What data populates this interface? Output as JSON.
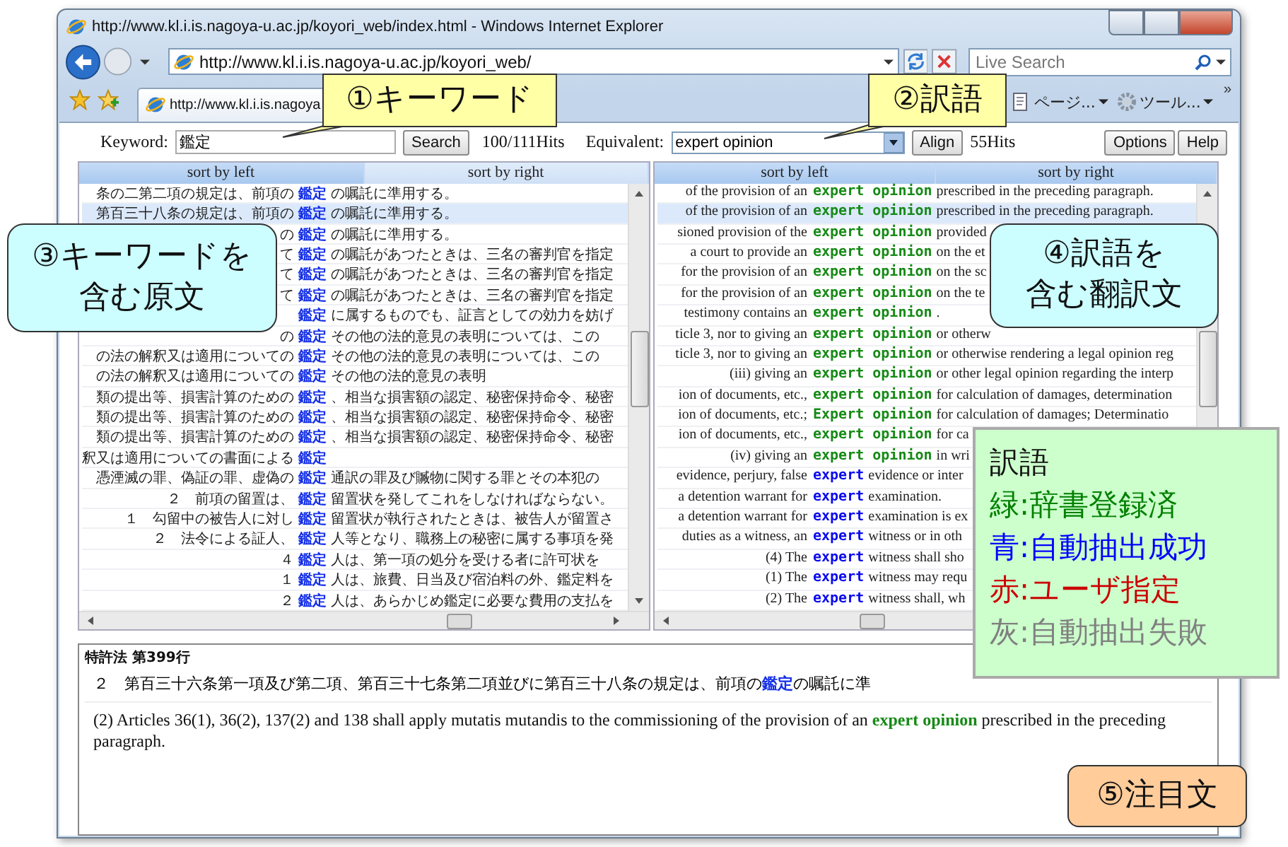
{
  "window": {
    "title": "http://www.kl.i.is.nagoya-u.ac.jp/koyori_web/index.html - Windows Internet Explorer"
  },
  "address_bar": {
    "url": "http://www.kl.i.is.nagoya-u.ac.jp/koyori_web/"
  },
  "search_box": {
    "placeholder": "Live Search"
  },
  "tab": {
    "title": "http://www.kl.i.is.nagoya"
  },
  "command_bar": [
    {
      "label": "ページ...",
      "kind": "page"
    },
    {
      "label": "ツール...",
      "kind": "tools"
    }
  ],
  "overflow": "»",
  "toolbar": {
    "keyword_label": "Keyword:",
    "keyword": "鑑定",
    "search_button": "Search",
    "hits": "100/111Hits",
    "equivalent_label": "Equivalent:",
    "equivalent": "expert opinion",
    "align_button": "Align",
    "equivalent_hits": "55Hits",
    "buttons": [
      "Options",
      "Help"
    ]
  },
  "panes": [
    {
      "headers": [
        "sort by left",
        "sort by right"
      ]
    },
    {
      "headers": [
        "sort by left",
        "sort by right"
      ]
    }
  ],
  "rows": [
    {
      "selected": false,
      "source": {
        "pre": "条の二第二項の規定は、前項の",
        "key": "鑑定",
        "post": "の嘱託に準用する。"
      },
      "translation": {
        "pre": "of the provision of an",
        "term": "expert opinion",
        "post": "prescribed in the preceding paragraph.",
        "kind": "dictionary"
      }
    },
    {
      "selected": true,
      "source": {
        "pre": "第百三十八条の規定は、前項の",
        "key": "鑑定",
        "post": "の嘱託に準用する。"
      },
      "translation": {
        "pre": "of the provision of an",
        "term": "expert opinion",
        "post": "prescribed in the preceding paragraph.",
        "kind": "dictionary"
      }
    },
    {
      "selected": false,
      "source": {
        "pre": "の",
        "key": "鑑定",
        "post": "の嘱託に準用する。"
      },
      "translation": {
        "pre": "sioned provision of the",
        "term": "expert opinion",
        "post": "provided",
        "kind": "dictionary"
      }
    },
    {
      "selected": false,
      "source": {
        "pre": "て",
        "key": "鑑定",
        "post": "の嘱託があつたときは、三名の審判官を指定"
      },
      "translation": {
        "pre": "a court to provide an",
        "term": "expert opinion",
        "post": "on the et",
        "kind": "dictionary"
      }
    },
    {
      "selected": false,
      "source": {
        "pre": "て",
        "key": "鑑定",
        "post": "の嘱託があつたときは、三名の審判官を指定"
      },
      "translation": {
        "pre": "for the provision of an",
        "term": "expert opinion",
        "post": "on the sc",
        "kind": "dictionary"
      }
    },
    {
      "selected": false,
      "source": {
        "pre": "て",
        "key": "鑑定",
        "post": "の嘱託があつたときは、三名の審判官を指定"
      },
      "translation": {
        "pre": "for the provision of an",
        "term": "expert opinion",
        "post": "on the te",
        "kind": "dictionary"
      }
    },
    {
      "selected": false,
      "source": {
        "key": "鑑定",
        "post": "に属するものでも、証言としての効力を妨げ"
      },
      "translation": {
        "pre": "testimony contains an",
        "term": "expert opinion",
        "post": ".",
        "kind": "dictionary"
      }
    },
    {
      "selected": false,
      "source": {
        "pre": "の",
        "key": "鑑定",
        "post": "その他の法的意見の表明については、この"
      },
      "translation": {
        "pre": "ticle 3, nor to giving an",
        "term": "expert opinion",
        "post": "or otherw",
        "kind": "dictionary"
      }
    },
    {
      "selected": false,
      "source": {
        "pre": "の法の解釈又は適用についての",
        "key": "鑑定",
        "post": "その他の法的意見の表明については、この"
      },
      "translation": {
        "pre": "ticle 3, nor to giving an",
        "term": "expert opinion",
        "post": "or otherwise rendering a legal opinion reg",
        "kind": "dictionary"
      }
    },
    {
      "selected": false,
      "source": {
        "pre": "の法の解釈又は適用についての",
        "key": "鑑定",
        "post": "その他の法的意見の表明"
      },
      "translation": {
        "pre": "(iii) giving an",
        "term": "expert opinion",
        "post": "or other legal opinion regarding the interp",
        "kind": "dictionary"
      }
    },
    {
      "selected": false,
      "source": {
        "pre": "類の提出等、損害計算のための",
        "key": "鑑定",
        "post": "、相当な損害額の認定、秘密保持命令、秘密"
      },
      "translation": {
        "pre": "ion of documents, etc.,",
        "term": "expert opinion",
        "post": "for calculation of damages, determination",
        "kind": "dictionary"
      }
    },
    {
      "selected": false,
      "source": {
        "pre": "類の提出等、損害計算のための",
        "key": "鑑定",
        "post": "、相当な損害額の認定、秘密保持命令、秘密"
      },
      "translation": {
        "pre": "ion of documents, etc.;",
        "term": "Expert opinion",
        "post": "for calculation of damages; Determinatio",
        "kind": "dictionary"
      }
    },
    {
      "selected": false,
      "source": {
        "pre": "類の提出等、損害計算のための",
        "key": "鑑定",
        "post": "、相当な損害額の認定、秘密保持命令、秘密"
      },
      "translation": {
        "pre": "ion of documents, etc.,",
        "term": "expert opinion",
        "post": "for ca",
        "kind": "dictionary"
      }
    },
    {
      "selected": false,
      "source": {
        "pre": "釈又は適用についての書面による",
        "key": "鑑定"
      },
      "translation": {
        "pre": "(iv) giving an",
        "term": "expert opinion",
        "post": "in wri",
        "kind": "dictionary"
      }
    },
    {
      "selected": false,
      "source": {
        "pre": "憑湮滅の罪、偽証の罪、虚偽の",
        "key": "鑑定",
        "post": "通訳の罪及び贓物に関する罪とその本犯の"
      },
      "translation": {
        "pre": "evidence, perjury, false",
        "term": "expert",
        "post": "evidence or inter",
        "kind": "auto"
      }
    },
    {
      "selected": false,
      "source": {
        "pre": "２　前項の留置は、",
        "key": "鑑定",
        "post": "留置状を発してこれをしなければならない。"
      },
      "translation": {
        "pre": "a detention warrant for",
        "term": "expert",
        "post": "examination.",
        "kind": "auto"
      }
    },
    {
      "selected": false,
      "source": {
        "pre": "１　勾留中の被告人に対し",
        "key": "鑑定",
        "post": "留置状が執行されたときは、被告人が留置さ"
      },
      "translation": {
        "pre": "a detention warrant for",
        "term": "expert",
        "post": "examination is ex",
        "kind": "auto"
      }
    },
    {
      "selected": false,
      "source": {
        "pre": "２　法令による証人、",
        "key": "鑑定",
        "post": "人等となり、職務上の秘密に属する事項を発"
      },
      "translation": {
        "pre": "duties as a witness, an",
        "term": "expert",
        "post": "witness or in oth",
        "kind": "auto"
      }
    },
    {
      "selected": false,
      "source": {
        "pre": "４",
        "key": "鑑定",
        "post": "人は、第一項の処分を受ける者に許可状を"
      },
      "translation": {
        "pre": "(4) The",
        "term": "expert",
        "post": "witness shall sho",
        "kind": "auto"
      }
    },
    {
      "selected": false,
      "source": {
        "pre": "１",
        "key": "鑑定",
        "post": "人は、旅費、日当及び宿泊料の外、鑑定料を"
      },
      "translation": {
        "pre": "(1) The",
        "term": "expert",
        "post": "witness may requ",
        "kind": "auto"
      }
    },
    {
      "selected": false,
      "source": {
        "pre": "２",
        "key": "鑑定",
        "post": "人は、あらかじめ鑑定に必要な費用の支払を"
      },
      "translation": {
        "pre": "(2) The",
        "term": "expert",
        "post": "witness shall, wh",
        "kind": "auto"
      }
    }
  ],
  "detail": {
    "title": "特許法 第399行",
    "source": {
      "pre": "２　第百三十六条第一項及び第二項、第百三十七条第二項並びに第百三十八条の規定は、前項の",
      "key": "鑑定",
      "post": "の嘱託に準"
    },
    "translation": {
      "pre": "(2) Articles 36(1), 36(2), 137(2) and 138 shall apply mutatis mutandis to the commissioning of the provision of an",
      "term": "expert opinion",
      "post": "prescribed in the preceding paragraph.",
      "kind": "dictionary"
    }
  },
  "callouts": [
    {
      "kind": "keyword",
      "lines": [
        "①キーワード"
      ]
    },
    {
      "kind": "equivalent",
      "lines": [
        "②訳語"
      ]
    },
    {
      "kind": "source",
      "lines": [
        "③キーワードを",
        "含む原文"
      ]
    },
    {
      "kind": "translation",
      "lines": [
        "④訳語を",
        "含む翻訳文"
      ]
    },
    {
      "kind": "focus",
      "lines": [
        "⑤注目文"
      ]
    }
  ],
  "legend": {
    "title": "訳語",
    "items": [
      {
        "text": "緑:辞書登録済",
        "color": "#008000"
      },
      {
        "text": "青:自動抽出成功",
        "color": "#0000ff"
      },
      {
        "text": "赤:ユーザ指定",
        "color": "#cc0000"
      },
      {
        "text": "灰:自動抽出失敗",
        "color": "#808080"
      }
    ]
  }
}
